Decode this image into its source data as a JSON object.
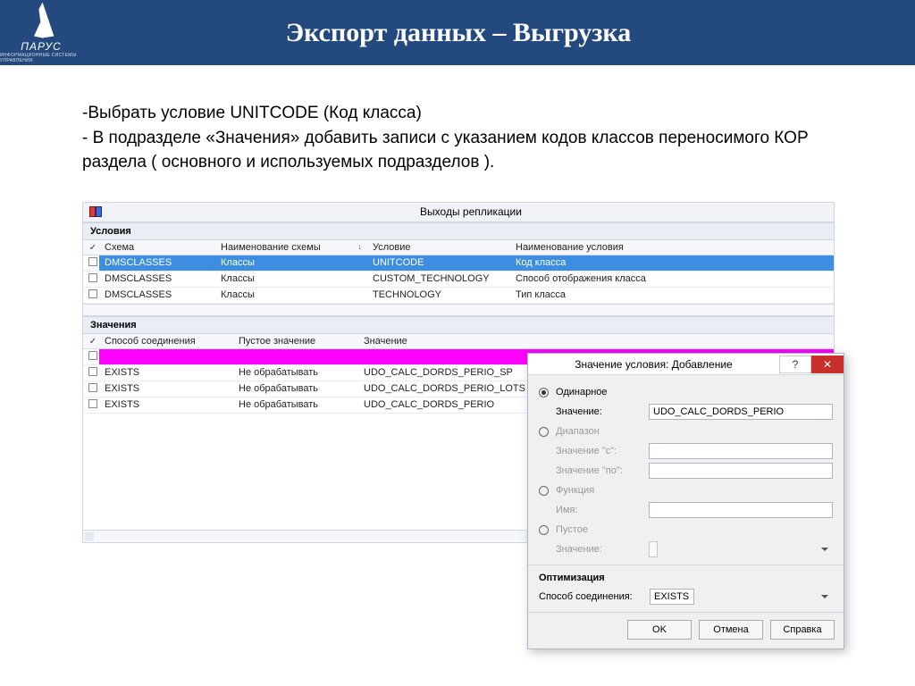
{
  "banner": {
    "logo_label": "ПАРУС",
    "logo_sub": "ИНФОРМАЦИОННЫЕ СИСТЕМЫ УПРАВЛЕНИЯ",
    "title": "Экспорт данных – Выгрузка"
  },
  "instructions": {
    "line1": "-Выбрать условие UNITCODE (Код класса)",
    "line2": "- В подразделе «Значения» добавить записи с указанием кодов классов переносимого КОР раздела ( основного и используемых подразделов )."
  },
  "app": {
    "title": "Выходы репликации",
    "conditions_label": "Условия",
    "cond_headers": {
      "schema": "Схема",
      "schema_name": "Наименование схемы",
      "cond": "Условие",
      "cond_name": "Наименование условия"
    },
    "cond_rows": [
      {
        "schema": "DMSCLASSES",
        "schema_name": "Классы",
        "cond": "UNITCODE",
        "cond_name": "Код класса",
        "selected": true
      },
      {
        "schema": "DMSCLASSES",
        "schema_name": "Классы",
        "cond": "CUSTOM_TECHNOLOGY",
        "cond_name": "Способ отображения класса"
      },
      {
        "schema": "DMSCLASSES",
        "schema_name": "Классы",
        "cond": "TECHNOLOGY",
        "cond_name": "Тип класса"
      }
    ],
    "values_label": "Значения",
    "val_headers": {
      "join": "Способ соединения",
      "empty": "Пустое значение",
      "value": "Значение"
    },
    "val_rows": [
      {
        "join": "",
        "empty": "",
        "value": "",
        "magenta": true
      },
      {
        "join": "EXISTS",
        "empty": "Не обрабатывать",
        "value": "UDO_CALC_DORDS_PERIO_SP"
      },
      {
        "join": "EXISTS",
        "empty": "Не обрабатывать",
        "value": "UDO_CALC_DORDS_PERIO_LOTS"
      },
      {
        "join": "EXISTS",
        "empty": "Не обрабатывать",
        "value": "UDO_CALC_DORDS_PERIO"
      }
    ]
  },
  "dialog": {
    "title": "Значение условия: Добавление",
    "radio_single": "Одинарное",
    "label_value": "Значение:",
    "value_input": "UDO_CALC_DORDS_PERIO",
    "radio_range": "Диапазон",
    "label_from": "Значение \"с\":",
    "label_to": "Значение \"по\":",
    "radio_func": "Функция",
    "label_name": "Имя:",
    "radio_empty": "Пустое",
    "label_empty_val": "Значение:",
    "opt_header": "Оптимизация",
    "label_join": "Способ соединения:",
    "join_value": "EXISTS",
    "btn_ok": "OK",
    "btn_cancel": "Отмена",
    "btn_help": "Справка"
  }
}
